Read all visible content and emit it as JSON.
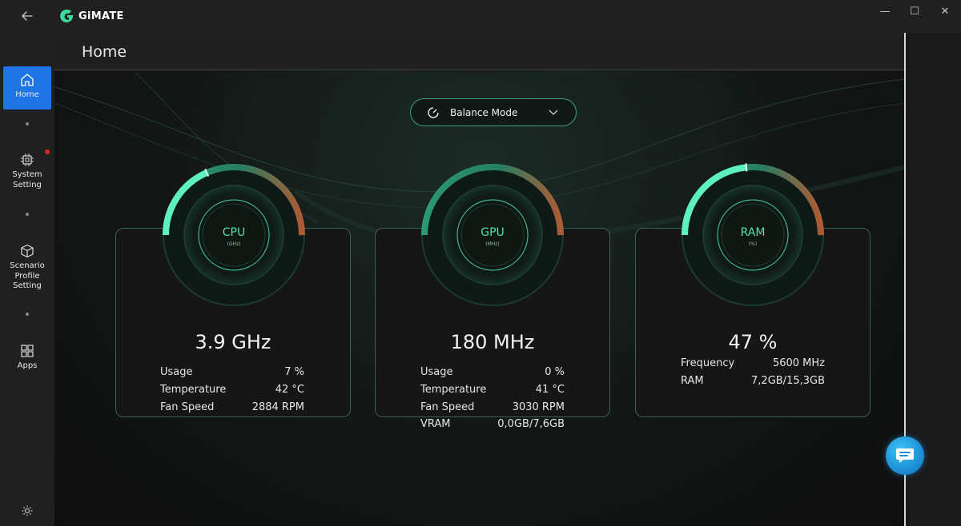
{
  "app": {
    "title": "GiMATE"
  },
  "window_controls": {
    "minimize": "—",
    "maximize": "☐",
    "close": "✕"
  },
  "sidebar": {
    "items": [
      {
        "label": "Home",
        "icon": "home-icon",
        "active": true
      },
      {
        "label": "System Setting",
        "icon": "chip-icon",
        "notification": true
      },
      {
        "label": "Scenario Profile Setting",
        "icon": "cube-icon"
      },
      {
        "label": "Apps",
        "icon": "apps-grid-icon"
      }
    ],
    "footer_icon": "settings-gear-icon"
  },
  "page": {
    "title": "Home"
  },
  "mode_selector": {
    "selected": "Balance Mode",
    "icon": "balance-mode-icon"
  },
  "colors": {
    "accent": "#55e0ae",
    "active_nav": "#1f74e6",
    "card_border": "#3a6156",
    "gauge_warm": "#c8663a"
  },
  "monitors": [
    {
      "name": "CPU",
      "unit": "(GHz)",
      "value": "3.9 GHz",
      "gauge_fraction": 0.37,
      "stats": [
        {
          "label": "Usage",
          "value": "7 %"
        },
        {
          "label": "Temperature",
          "value": "42 °C"
        },
        {
          "label": "Fan Speed",
          "value": "2884 RPM"
        }
      ]
    },
    {
      "name": "GPU",
      "unit": "(MHz)",
      "value": "180 MHz",
      "gauge_fraction": 0.0,
      "stats": [
        {
          "label": "Usage",
          "value": "0 %"
        },
        {
          "label": "Temperature",
          "value": "41 °C"
        },
        {
          "label": "Fan Speed",
          "value": "3030 RPM"
        },
        {
          "label": "VRAM",
          "value": "0,0GB/7,6GB"
        }
      ]
    },
    {
      "name": "RAM",
      "unit": "(%)",
      "value": "47 %",
      "gauge_fraction": 0.47,
      "stats": [
        {
          "label": "Frequency",
          "value": "5600 MHz"
        },
        {
          "label": "RAM",
          "value": "7,2GB/15,3GB"
        }
      ]
    }
  ],
  "chat": {
    "icon": "chat-bubble-icon"
  }
}
